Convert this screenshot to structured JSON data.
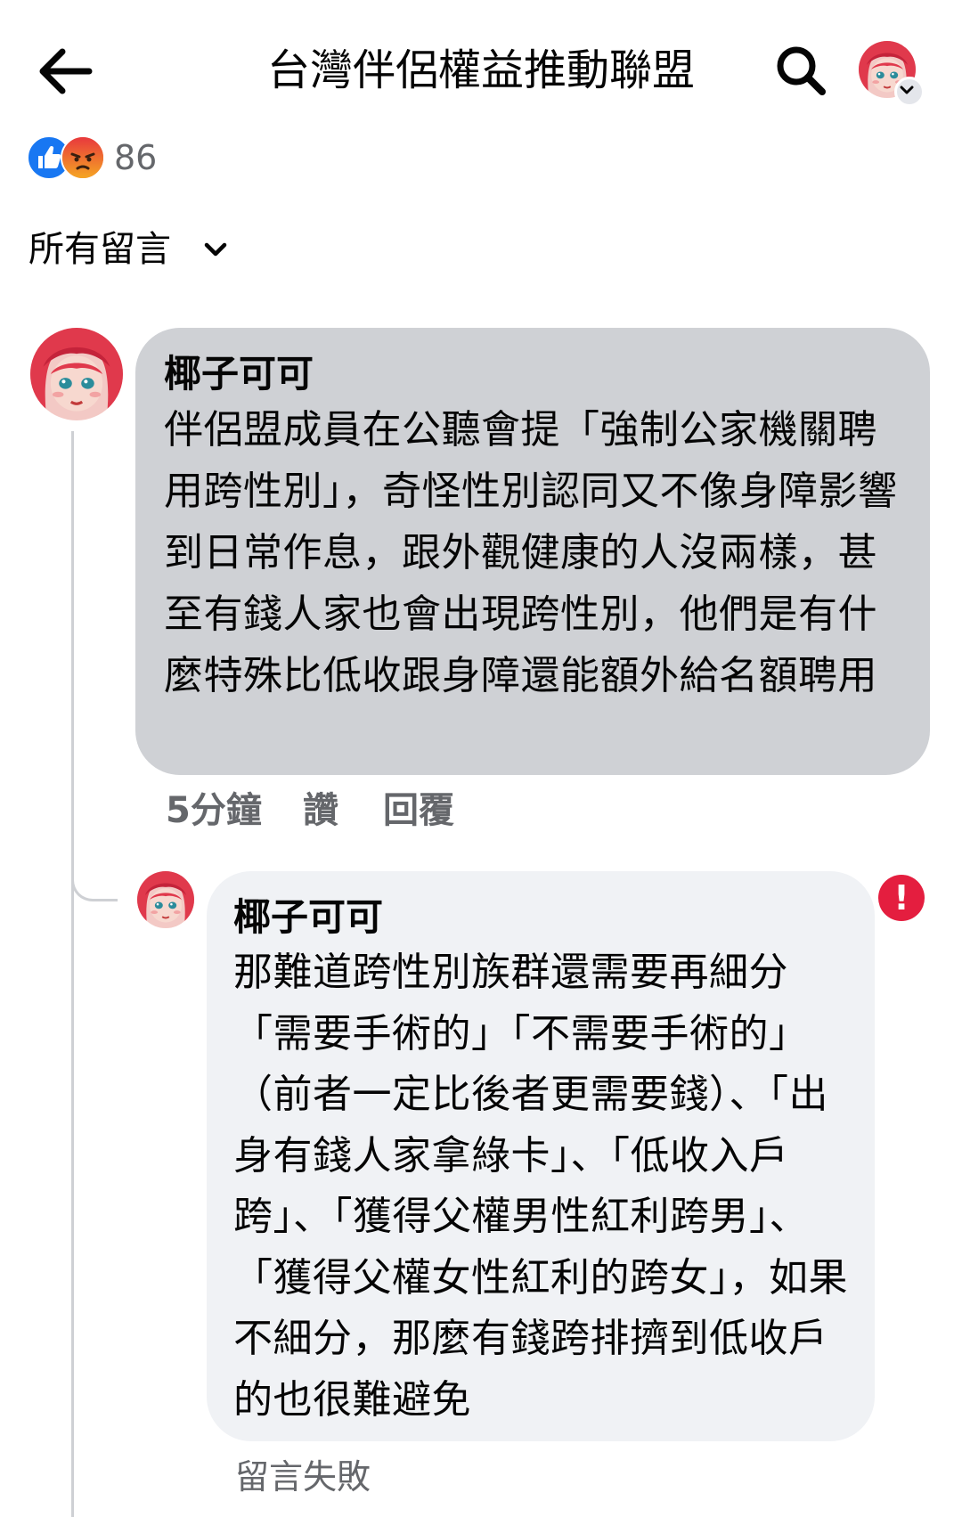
{
  "header": {
    "title": "台灣伴侶權益推動聯盟",
    "back_icon": "arrow-left-icon",
    "search_icon": "search-icon",
    "profile_icon": "avatar"
  },
  "reactions": {
    "icons": [
      "like-icon",
      "angry-icon"
    ],
    "count": "86"
  },
  "filter": {
    "label": "所有留言"
  },
  "comments": [
    {
      "author": "椰子可可",
      "text": "伴侶盟成員在公聽會提「強制公家機關聘用跨性別」，奇怪性別認同又不像身障影響到日常作息，跟外觀健康的人沒兩樣，甚至有錢人家也會出現跨性別，他們是有什麼特殊比低收跟身障還能額外給名額聘用",
      "time": "5分鐘",
      "like_label": "讚",
      "reply_label": "回覆"
    }
  ],
  "reply": {
    "author": "椰子可可",
    "text": "那難道跨性別族群還需要再細分「需要手術的」「不需要手術的」（前者一定比後者更需要錢）、「出身有錢人家拿綠卡」、「低收入戶跨」、「獲得父權男性紅利跨男」、「獲得父權女性紅利的跨女」，如果不細分，那麼有錢跨排擠到低收戶的也很難避免",
    "error_mark": "!",
    "status": "留言失敗"
  },
  "colors": {
    "like_blue": "#1877f2",
    "angry_orange": "#f0622d",
    "error_red": "#e41e3f",
    "main_bubble": "#cfd1d5",
    "reply_bubble": "#f0f2f5"
  }
}
